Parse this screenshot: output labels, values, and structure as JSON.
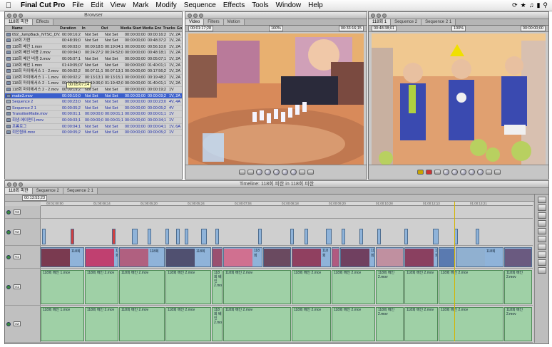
{
  "menubar": {
    "app_name": "Final Cut Pro",
    "items": [
      "File",
      "Edit",
      "View",
      "Mark",
      "Modify",
      "Sequence",
      "Effects",
      "Tools",
      "Window",
      "Help"
    ]
  },
  "browser": {
    "title": "Browser",
    "tabs": [
      "118회 피한",
      "Effects"
    ],
    "columns": [
      "Name",
      "Duration",
      "In",
      "Out",
      "Media Start",
      "Media End",
      "Tracks",
      "Go"
    ],
    "rows": [
      [
        "092_JumpBack_NTSC_DV.mov",
        "00:00:16:2",
        "Not Set",
        "Not Set",
        "00:00:00;00",
        "00:00:16:2",
        "1V, 2A"
      ],
      [
        "118회 가현",
        "00:48:39;0",
        "Not Set",
        "Not Set",
        "00:00:00;00",
        "00:48:37;2",
        "1V, 2A"
      ],
      [
        "118회 베인 1.mov",
        "00:00:03;0",
        "00:00:18:59;3",
        "00:19:04;1",
        "00:00:00;00",
        "00:56:10;0",
        "1V, 2A"
      ],
      [
        "118회 베인 비용 2.mov",
        "00:00:04;0",
        "00:24:27;2",
        "00:24:52;0",
        "00:00:00;00",
        "00:48:18;1",
        "1V, 2A"
      ],
      [
        "118회 베인 비용 3.mov",
        "00:05:07;1",
        "Not Set",
        "Not Set",
        "00:00:00;00",
        "00:05:07;1",
        "1V, 2A"
      ],
      [
        "118회 베인 1.mov",
        "01:40:05;07",
        "Not Set",
        "Not Set",
        "00:00:00;00",
        "01:40:01;1",
        "1V, 2A"
      ],
      [
        "118회 마이에서스 1 - 2.mov",
        "00:00:02;2",
        "00:07:11;1",
        "00:07:13;1",
        "00:00:00;00",
        "00:17:56;2",
        "1V, 2A"
      ],
      [
        "118회 마이에서스 1 - 1.mov",
        "00:00:02;2",
        "00:13:13;1",
        "00:13:15;1",
        "00:00:00;00",
        "00:19:48;2",
        "1V, 2A"
      ],
      [
        "118회 마이에서스 2 - 1.mov",
        "00:00:05;2",
        "01:19:36;0",
        "01:19:42;0",
        "00:00:00;00",
        "01:40:01;1",
        "1V, 2A"
      ],
      [
        "118회 마이에서스 2 - 2.mov",
        "00:00:19;2",
        "Not Set",
        "Not Set",
        "00:00:00;00",
        "00:00:19;2",
        "1V"
      ],
      [
        "matte3.mov",
        "00:00:10;0",
        "Not Set",
        "Not Set",
        "00:00:00;00",
        "00:00:09;2",
        "1V, 2A"
      ],
      [
        "Sequence 2",
        "00:00:23;0",
        "Not Set",
        "Not Set",
        "00:00:00;00",
        "00:00:23;0",
        "4V, 4A"
      ],
      [
        "Sequence 2 1",
        "00:00:05;2",
        "Not Set",
        "Not Set",
        "00:00:00;00",
        "00:00:05;2",
        "4V"
      ],
      [
        "TransitionMatte.mov",
        "00:00:01;1",
        "00:00:00;0",
        "00:00:01;1",
        "00:00:00;00",
        "00:00:01;1",
        "1V"
      ],
      [
        "회생-에이면디.mov",
        "00:00:03;1",
        "00:00:00;0",
        "00:00:01;1",
        "00:00:00;00",
        "00:00:34;1",
        "1V"
      ],
      [
        "프롬로그",
        "00:00:04;1",
        "Not Set",
        "Not Set",
        "00:00:00;00",
        "00:00:04;1",
        "1V, 6A"
      ],
      [
        "회전원표.mov",
        "00:00:05;2",
        "Not Set",
        "Not Set",
        "00:00:00;00",
        "00:00:05;2",
        "1V"
      ]
    ],
    "selected_index": 10,
    "tooltip": "00:05:07;14"
  },
  "viewer": {
    "tabs": [
      "Video",
      "Filters",
      "Motion"
    ],
    "tc_duration": "00:01:17;28",
    "tc_current": "00:33:16;15",
    "zoom": "100%"
  },
  "canvas": {
    "tabs": [
      "118회 1",
      "Sequence 2",
      "Sequence 2 1"
    ],
    "tc_duration": "00:48:38;01",
    "tc_current": "00:00:00;00",
    "zoom": "100%"
  },
  "timeline": {
    "title": "Timeline: 118회 피한 in 118회 피한",
    "tabs": [
      "118회 피한",
      "Sequence 2",
      "Sequence 2 1"
    ],
    "tc_current": "00:13:53;23",
    "ruler": [
      "00:01:00:00",
      "01:00:08;14",
      "01:00:05;20",
      "01:00:05;24",
      "01:00:07;04",
      "01:00:08;18",
      "01:00:09;20",
      "01:00:10;28",
      "01:00:12;13",
      "01:00:13;21"
    ],
    "tracks": [
      "V3",
      "V2",
      "V1",
      "A1",
      "A2"
    ],
    "audio_label": "118회 베인 2.mov",
    "audio_label_alt": "118회 베인 1.mov",
    "video_label": "118회"
  }
}
